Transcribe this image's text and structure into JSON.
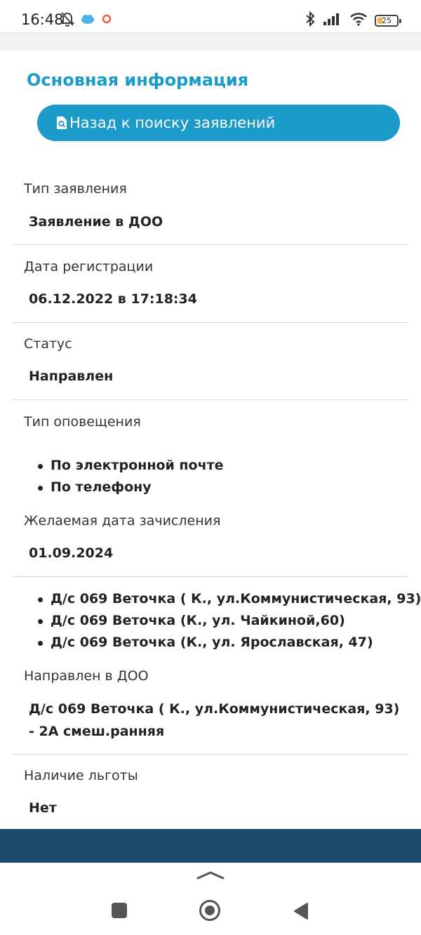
{
  "status_bar": {
    "time": "16:48",
    "left_icons": [
      "muted-bell-icon",
      "cloud-app-icon",
      "record-icon"
    ],
    "right_icons": [
      "bluetooth-icon",
      "signal-icon",
      "wifi-icon"
    ],
    "battery_percent": "25",
    "battery_level": 0.25,
    "battery_color": "#f2b94a"
  },
  "main": {
    "section_title": "Основная информация",
    "back_button_label": "Назад к поиску заявлений",
    "back_button_icon": "search-document-icon",
    "accent_color": "#1a9bc9"
  },
  "fields": {
    "application_type": {
      "label": "Тип заявления",
      "value": "Заявление в ДОО"
    },
    "registration_date": {
      "label": "Дата регистрации",
      "value": "06.12.2022 в 17:18:34"
    },
    "status": {
      "label": "Статус",
      "value": "Направлен"
    },
    "notification_type": {
      "label": "Тип оповещения",
      "items": [
        "По электронной почте",
        "По телефону"
      ]
    },
    "desired_enrollment_date": {
      "label": "Желаемая дата зачисления",
      "value": "01.09.2024"
    },
    "kindergartens": [
      "Д/с 069 Веточка ( К., ул.Коммунистическая, 93)",
      "Д/с 069 Веточка (К., ул. Чайкиной,60)",
      "Д/с 069 Веточка (К., ул. Ярославская, 47)"
    ],
    "directed_to": {
      "label": "Направлен в ДОО",
      "value": "Д/с 069 Веточка ( К., ул.Коммунистическая, 93) - 2А смеш.ранняя"
    },
    "benefit": {
      "label": "Наличие льготы",
      "value": "Нет"
    }
  },
  "footer": {
    "band_color": "#1c4a69"
  },
  "nav_bar": {
    "icons": [
      "chevron-up-icon",
      "recents-square-icon",
      "home-circle-icon",
      "back-triangle-icon"
    ]
  }
}
